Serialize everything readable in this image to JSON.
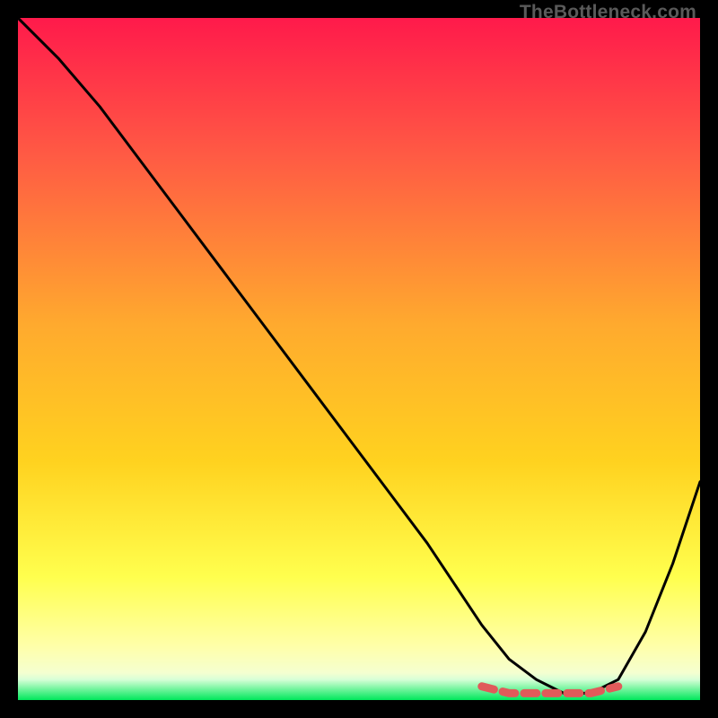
{
  "watermark": "TheBottleneck.com",
  "colors": {
    "gradient_top": "#ff1a4b",
    "gradient_mid1": "#ff6a3c",
    "gradient_mid2": "#ffd21f",
    "gradient_yellow": "#ffff4e",
    "gradient_yellow_pale": "#ffffa8",
    "gradient_green": "#00e85c",
    "curve": "#000000",
    "highlight": "#e05a5a",
    "frame": "#000000"
  },
  "chart_data": {
    "type": "line",
    "title": "",
    "xlabel": "",
    "ylabel": "",
    "xlim": [
      0,
      100
    ],
    "ylim": [
      0,
      100
    ],
    "series": [
      {
        "name": "bottleneck-curve",
        "x": [
          0,
          6,
          12,
          18,
          24,
          30,
          36,
          42,
          48,
          54,
          60,
          64,
          68,
          72,
          76,
          80,
          84,
          88,
          92,
          96,
          100
        ],
        "values": [
          100,
          94,
          87,
          79,
          71,
          63,
          55,
          47,
          39,
          31,
          23,
          17,
          11,
          6,
          3,
          1,
          1,
          3,
          10,
          20,
          32
        ]
      },
      {
        "name": "optimal-band",
        "x": [
          68,
          72,
          76,
          80,
          84,
          88
        ],
        "values": [
          2,
          1,
          1,
          1,
          1,
          2
        ]
      }
    ],
    "annotations": []
  }
}
